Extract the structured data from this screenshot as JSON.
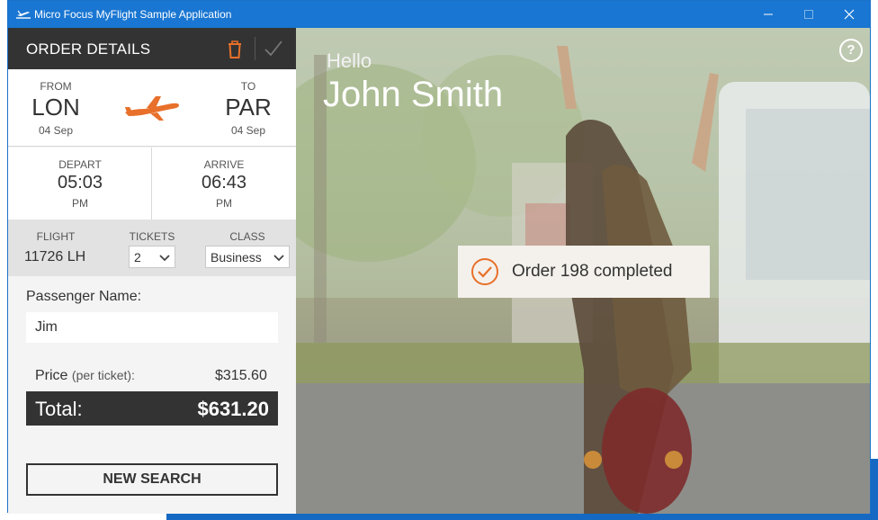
{
  "window": {
    "title": "Micro Focus MyFlight Sample Application",
    "accent": "#1976d2"
  },
  "order": {
    "header": "ORDER DETAILS",
    "from_label": "FROM",
    "from_code": "LON",
    "from_date": "04 Sep",
    "to_label": "TO",
    "to_code": "PAR",
    "to_date": "04 Sep",
    "depart_label": "DEPART",
    "depart_time": "05:03",
    "depart_ampm": "PM",
    "arrive_label": "ARRIVE",
    "arrive_time": "06:43",
    "arrive_ampm": "PM",
    "flight_label": "FLIGHT",
    "flight_value": "11726 LH",
    "tickets_label": "TICKETS",
    "tickets_value": "2",
    "class_label": "CLASS",
    "class_value": "Business",
    "passenger_label": "Passenger Name:",
    "passenger_value": "Jim",
    "price_label": "Price",
    "price_sub": "(per ticket):",
    "price_value": "$315.60",
    "total_label": "Total:",
    "total_value": "$631.20",
    "new_search": "NEW SEARCH",
    "orange": "#e8702a"
  },
  "greeting": {
    "hello": "Hello",
    "name": "John Smith",
    "help": "?"
  },
  "toast": {
    "message": "Order 198 completed"
  }
}
